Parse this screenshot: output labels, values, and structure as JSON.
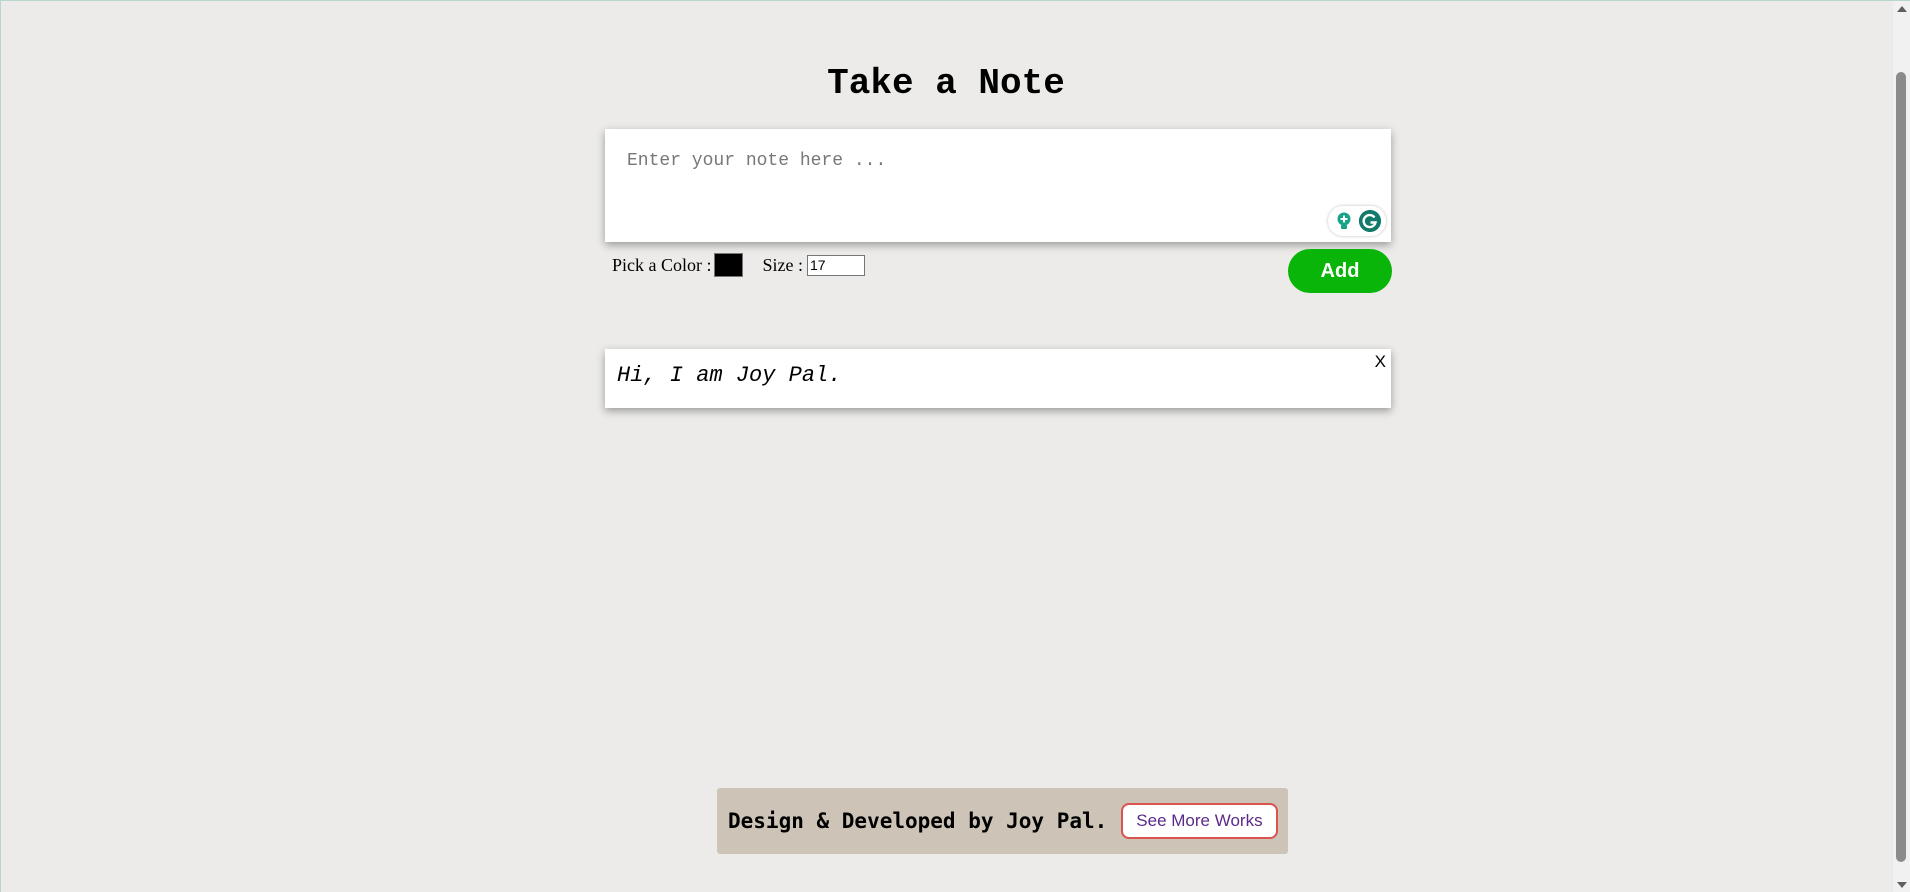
{
  "header": {
    "title": "Take a Note"
  },
  "note_input": {
    "placeholder": "Enter your note here ...",
    "value": ""
  },
  "controls": {
    "color_label": "Pick a Color :",
    "color_value": "#000000",
    "size_label": "Size :",
    "size_value": "17",
    "add_label": "Add"
  },
  "notes": [
    {
      "text": "Hi, I am Joy Pal.",
      "close_label": "X"
    }
  ],
  "footer": {
    "credit": "Design & Developed by Joy Pal.",
    "more_label": "See More Works"
  },
  "colors": {
    "background": "#ecebe9",
    "add_button": "#08b508",
    "footer_bg": "#cdc4b7",
    "more_border": "#d9534f",
    "more_text": "#5b2a8a"
  },
  "icons": [
    "lightbulb-icon",
    "grammarly-icon"
  ]
}
